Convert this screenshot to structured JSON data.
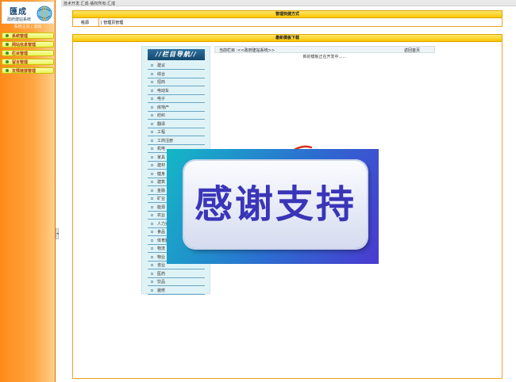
{
  "logo": {
    "title": "匯成",
    "subtitle": "政府建站系统"
  },
  "sidebar": {
    "header": "系统主页 | 退出",
    "items": [
      {
        "label": "系统管理"
      },
      {
        "label": "网站信息管理"
      },
      {
        "label": "栏目管理"
      },
      {
        "label": "留言管理"
      },
      {
        "label": "友情链接管理"
      }
    ]
  },
  "topbar": {
    "text": "技术开发:汇成-版权所有:汇成"
  },
  "quick_panel": {
    "title": "管理快捷方式",
    "home": "桃源",
    "page": "| 管理页管理"
  },
  "template_panel": {
    "title": "最新模板下载"
  },
  "nav": {
    "banner": "//栏目导航//",
    "items": [
      {
        "label": "建议"
      },
      {
        "label": "综合"
      },
      {
        "label": "招商"
      },
      {
        "label": "电动车"
      },
      {
        "label": "电子"
      },
      {
        "label": "房地产"
      },
      {
        "label": "纺织"
      },
      {
        "label": "翻译"
      },
      {
        "label": "工程"
      },
      {
        "label": "工商注册"
      },
      {
        "label": "机电"
      },
      {
        "label": "家具"
      },
      {
        "label": "建材"
      },
      {
        "label": "健身"
      },
      {
        "label": "建筑"
      },
      {
        "label": "金融"
      },
      {
        "label": "矿业"
      },
      {
        "label": "能源"
      },
      {
        "label": "农业"
      },
      {
        "label": "人力资源"
      },
      {
        "label": "食品"
      },
      {
        "label": "体育器"
      },
      {
        "label": "物流"
      },
      {
        "label": "物业"
      },
      {
        "label": "咨业"
      },
      {
        "label": "医药"
      },
      {
        "label": "饮品"
      },
      {
        "label": "装修"
      }
    ]
  },
  "content": {
    "crumb": "当前栏目 :<<政府建站系统>>",
    "back": "返回首页",
    "message": "新的模板正在开发中……"
  },
  "overlay": {
    "text": "感谢支持"
  },
  "collapse_handle": {
    "glyph": "◂"
  }
}
